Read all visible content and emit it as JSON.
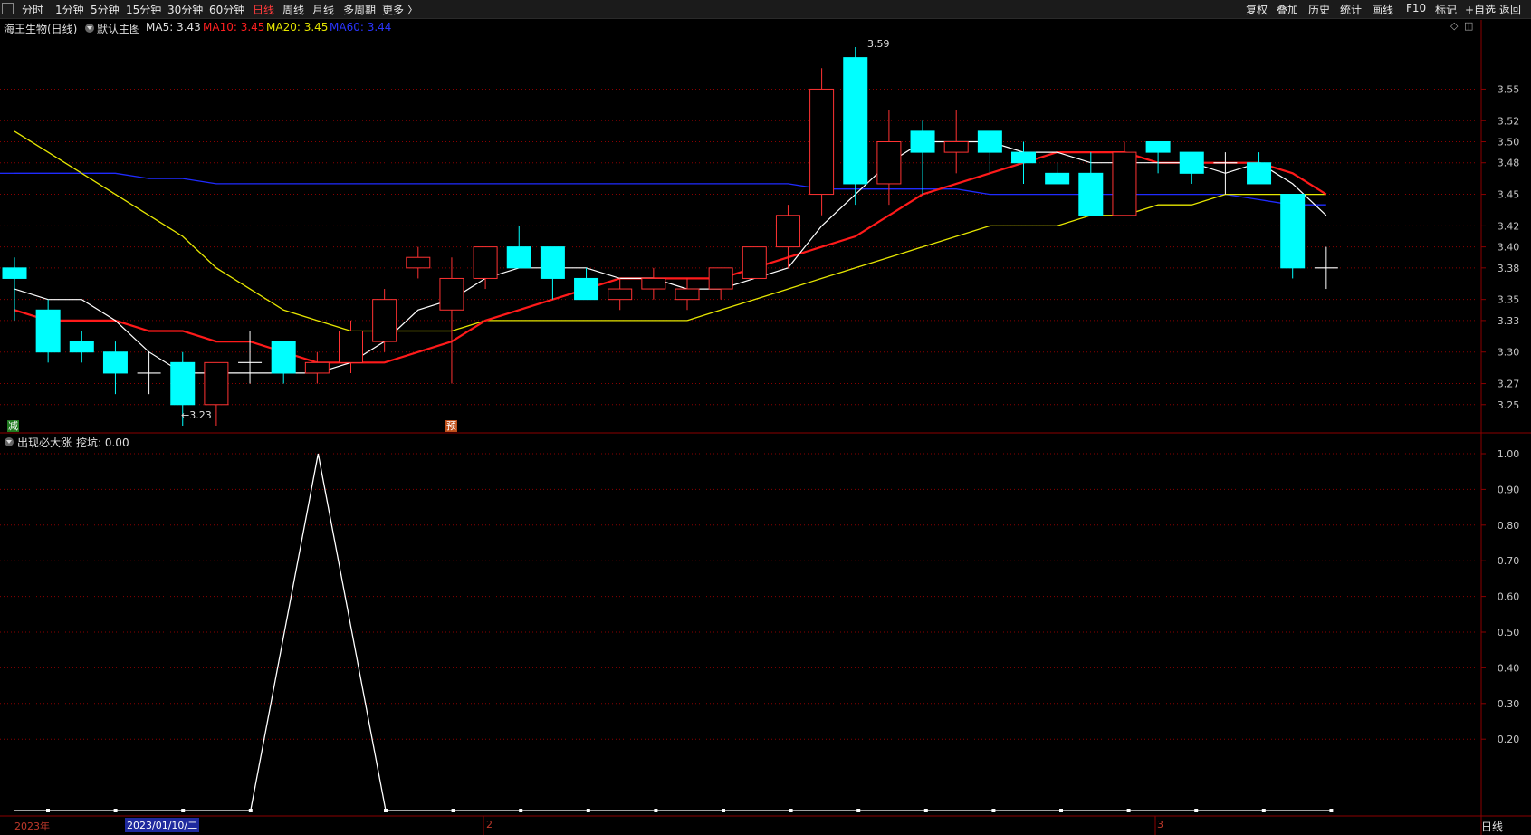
{
  "toolbar": {
    "periods": [
      "分时",
      "1分钟",
      "5分钟",
      "15分钟",
      "30分钟",
      "60分钟",
      "日线",
      "周线",
      "月线",
      "多周期",
      "更多 〉"
    ],
    "active_period": "日线",
    "right_buttons": [
      "复权",
      "叠加",
      "历史",
      "统计",
      "画线",
      "F10",
      "标记",
      "+自选",
      "返回"
    ]
  },
  "main_panel": {
    "title": "海王生物(日线)",
    "indicator": "默认主图",
    "ma5": "MA5: 3.43",
    "ma10": "MA10: 3.45",
    "ma20": "MA20: 3.45",
    "ma60": "MA60: 3.44",
    "high_label": "3.59",
    "low_label": "←3.23",
    "badge_left": "减",
    "badge_mid": "预"
  },
  "sub_panel": {
    "title": "出现必大涨",
    "value": "挖坑: 0.00"
  },
  "bottom": {
    "year_label": "2023年",
    "cursor_date": "2023/01/10/二",
    "month2": "2",
    "month3": "3",
    "right_label": "日线"
  },
  "colors": {
    "up": "#ff3232",
    "down": "#00ffff",
    "ma5": "#ffffff",
    "ma10": "#ff1a1a",
    "ma20": "#e6e600",
    "ma60": "#1f2bff",
    "grid": "#8b0000"
  },
  "chart_data": {
    "type": "candlestick",
    "price_axis": [
      3.55,
      3.52,
      3.5,
      3.48,
      3.45,
      3.42,
      3.4,
      3.38,
      3.35,
      3.33,
      3.3,
      3.27,
      3.25
    ],
    "ylim": [
      3.22,
      3.6
    ],
    "candles": [
      {
        "o": 3.38,
        "h": 3.39,
        "l": 3.33,
        "c": 3.37
      },
      {
        "o": 3.34,
        "h": 3.35,
        "l": 3.29,
        "c": 3.3
      },
      {
        "o": 3.31,
        "h": 3.32,
        "l": 3.29,
        "c": 3.3
      },
      {
        "o": 3.3,
        "h": 3.31,
        "l": 3.26,
        "c": 3.28
      },
      {
        "o": 3.28,
        "h": 3.3,
        "l": 3.26,
        "c": 3.28
      },
      {
        "o": 3.29,
        "h": 3.3,
        "l": 3.23,
        "c": 3.25
      },
      {
        "o": 3.25,
        "h": 3.29,
        "l": 3.23,
        "c": 3.29
      },
      {
        "o": 3.29,
        "h": 3.32,
        "l": 3.27,
        "c": 3.29
      },
      {
        "o": 3.31,
        "h": 3.31,
        "l": 3.27,
        "c": 3.28
      },
      {
        "o": 3.28,
        "h": 3.3,
        "l": 3.27,
        "c": 3.29
      },
      {
        "o": 3.29,
        "h": 3.33,
        "l": 3.28,
        "c": 3.32
      },
      {
        "o": 3.31,
        "h": 3.36,
        "l": 3.3,
        "c": 3.35
      },
      {
        "o": 3.38,
        "h": 3.4,
        "l": 3.37,
        "c": 3.39
      },
      {
        "o": 3.34,
        "h": 3.39,
        "l": 3.27,
        "c": 3.37
      },
      {
        "o": 3.37,
        "h": 3.4,
        "l": 3.36,
        "c": 3.4
      },
      {
        "o": 3.4,
        "h": 3.42,
        "l": 3.38,
        "c": 3.38
      },
      {
        "o": 3.4,
        "h": 3.4,
        "l": 3.35,
        "c": 3.37
      },
      {
        "o": 3.37,
        "h": 3.38,
        "l": 3.35,
        "c": 3.35
      },
      {
        "o": 3.35,
        "h": 3.37,
        "l": 3.34,
        "c": 3.36
      },
      {
        "o": 3.36,
        "h": 3.38,
        "l": 3.35,
        "c": 3.37
      },
      {
        "o": 3.35,
        "h": 3.37,
        "l": 3.34,
        "c": 3.36
      },
      {
        "o": 3.36,
        "h": 3.38,
        "l": 3.35,
        "c": 3.38
      },
      {
        "o": 3.37,
        "h": 3.4,
        "l": 3.37,
        "c": 3.4
      },
      {
        "o": 3.4,
        "h": 3.44,
        "l": 3.38,
        "c": 3.43
      },
      {
        "o": 3.45,
        "h": 3.57,
        "l": 3.43,
        "c": 3.55
      },
      {
        "o": 3.58,
        "h": 3.59,
        "l": 3.44,
        "c": 3.46
      },
      {
        "o": 3.46,
        "h": 3.53,
        "l": 3.44,
        "c": 3.5
      },
      {
        "o": 3.51,
        "h": 3.52,
        "l": 3.45,
        "c": 3.49
      },
      {
        "o": 3.49,
        "h": 3.53,
        "l": 3.47,
        "c": 3.5
      },
      {
        "o": 3.51,
        "h": 3.51,
        "l": 3.47,
        "c": 3.49
      },
      {
        "o": 3.49,
        "h": 3.5,
        "l": 3.46,
        "c": 3.48
      },
      {
        "o": 3.47,
        "h": 3.48,
        "l": 3.46,
        "c": 3.46
      },
      {
        "o": 3.47,
        "h": 3.49,
        "l": 3.43,
        "c": 3.43
      },
      {
        "o": 3.43,
        "h": 3.5,
        "l": 3.43,
        "c": 3.49
      },
      {
        "o": 3.5,
        "h": 3.5,
        "l": 3.47,
        "c": 3.49
      },
      {
        "o": 3.49,
        "h": 3.49,
        "l": 3.46,
        "c": 3.47
      },
      {
        "o": 3.48,
        "h": 3.49,
        "l": 3.45,
        "c": 3.48
      },
      {
        "o": 3.48,
        "h": 3.49,
        "l": 3.46,
        "c": 3.46
      },
      {
        "o": 3.45,
        "h": 3.45,
        "l": 3.37,
        "c": 3.38
      },
      {
        "o": 3.38,
        "h": 3.4,
        "l": 3.36,
        "c": 3.38
      }
    ],
    "ma5": [
      3.36,
      3.35,
      3.35,
      3.33,
      3.3,
      3.28,
      3.28,
      3.28,
      3.28,
      3.28,
      3.29,
      3.31,
      3.34,
      3.35,
      3.37,
      3.38,
      3.38,
      3.38,
      3.37,
      3.37,
      3.36,
      3.36,
      3.37,
      3.38,
      3.42,
      3.45,
      3.48,
      3.5,
      3.5,
      3.5,
      3.49,
      3.49,
      3.48,
      3.48,
      3.48,
      3.48,
      3.47,
      3.48,
      3.46,
      3.43
    ],
    "ma10": [
      3.34,
      3.33,
      3.33,
      3.33,
      3.32,
      3.32,
      3.31,
      3.31,
      3.3,
      3.29,
      3.29,
      3.29,
      3.3,
      3.31,
      3.33,
      3.34,
      3.35,
      3.36,
      3.37,
      3.37,
      3.37,
      3.37,
      3.38,
      3.39,
      3.4,
      3.41,
      3.43,
      3.45,
      3.46,
      3.47,
      3.48,
      3.49,
      3.49,
      3.49,
      3.48,
      3.48,
      3.48,
      3.48,
      3.47,
      3.45
    ],
    "ma20": [
      3.51,
      3.49,
      3.47,
      3.45,
      3.43,
      3.41,
      3.38,
      3.36,
      3.34,
      3.33,
      3.32,
      3.32,
      3.32,
      3.32,
      3.33,
      3.33,
      3.33,
      3.33,
      3.33,
      3.33,
      3.33,
      3.34,
      3.35,
      3.36,
      3.37,
      3.38,
      3.39,
      3.4,
      3.41,
      3.42,
      3.42,
      3.42,
      3.43,
      3.43,
      3.44,
      3.44,
      3.45,
      3.45,
      3.45,
      3.45
    ],
    "ma60": [
      3.47,
      3.47,
      3.47,
      3.47,
      3.465,
      3.465,
      3.46,
      3.46,
      3.46,
      3.46,
      3.46,
      3.46,
      3.46,
      3.46,
      3.46,
      3.46,
      3.46,
      3.46,
      3.46,
      3.46,
      3.46,
      3.46,
      3.46,
      3.46,
      3.455,
      3.455,
      3.455,
      3.455,
      3.455,
      3.45,
      3.45,
      3.45,
      3.45,
      3.45,
      3.45,
      3.45,
      3.45,
      3.445,
      3.44,
      3.44
    ],
    "sub_axis": [
      1.0,
      0.9,
      0.8,
      0.7,
      0.6,
      0.5,
      0.4,
      0.3,
      0.2
    ],
    "sub_ylim": [
      0,
      1.0
    ],
    "sub_values": [
      0,
      0,
      0,
      0,
      1,
      0,
      0,
      0,
      0,
      0,
      0,
      0,
      0,
      0,
      0,
      0,
      0,
      0,
      0,
      0
    ]
  }
}
